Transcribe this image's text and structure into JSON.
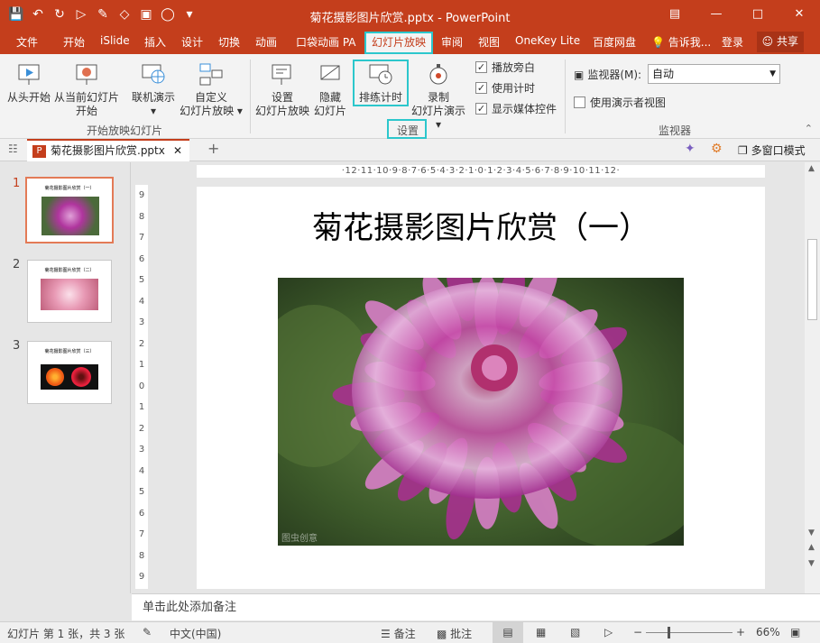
{
  "window": {
    "title": "菊花摄影图片欣赏.pptx - PowerPoint"
  },
  "qat": {
    "items": [
      "save-icon",
      "undo-icon",
      "redo-icon",
      "start-from-beginning-icon",
      "format-painter-icon",
      "shapes-icon",
      "picture-icon",
      "sync-icon",
      "more-icon"
    ]
  },
  "tabs": [
    "文件",
    "开始",
    "iSlide",
    "插入",
    "设计",
    "切换",
    "动画",
    "口袋动画 PA",
    "幻灯片放映",
    "审阅",
    "视图",
    "OneKey Lite",
    "百度网盘"
  ],
  "active_tab": "幻灯片放映",
  "tell_me": "告诉我...",
  "signin": "登录",
  "share": "共享",
  "ribbon": {
    "from_beginning": "从头开始",
    "from_current_1": "从当前幻灯片",
    "from_current_2": "开始",
    "online_present": "联机演示",
    "custom_1": "自定义",
    "custom_2": "幻灯片放映",
    "group1_label": "开始放映幻灯片",
    "setup_1": "设置",
    "setup_2": "幻灯片放映",
    "hide_1": "隐藏",
    "hide_2": "幻灯片",
    "rehearse": "排练计时",
    "record_1": "录制",
    "record_2": "幻灯片演示",
    "play_narrations": "播放旁白",
    "use_timings": "使用计时",
    "show_media_controls": "显示媒体控件",
    "group2_label": "设置",
    "monitor_label": "监视器(M):",
    "monitor_value": "自动",
    "presenter_view": "使用演示者视图",
    "group3_label": "监视器"
  },
  "doc_tab": {
    "name": "菊花摄影图片欣赏.pptx",
    "multi_window": "多窗口模式"
  },
  "hruler": "·12·11·10·9·8·7·6·5·4·3·2·1·0·1·2·3·4·5·6·7·8·9·10·11·12·",
  "vruler": [
    "9",
    "8",
    "7",
    "6",
    "5",
    "4",
    "3",
    "2",
    "1",
    "0",
    "1",
    "2",
    "3",
    "4",
    "5",
    "6",
    "7",
    "8",
    "9"
  ],
  "thumbnails": [
    {
      "num": "1",
      "title": "菊花摄影图片欣赏（一）"
    },
    {
      "num": "2",
      "title": "菊花摄影图片欣赏（二）"
    },
    {
      "num": "3",
      "title": "菊花摄影图片欣赏（三）"
    }
  ],
  "slide": {
    "title": "菊花摄影图片欣赏（一）",
    "watermark": "图虫创意"
  },
  "notes_placeholder": "单击此处添加备注",
  "status": {
    "slide_info": "幻灯片 第 1 张，共 3 张",
    "language": "中文(中国)",
    "notes": "备注",
    "comments": "批注",
    "zoom": "66%"
  }
}
